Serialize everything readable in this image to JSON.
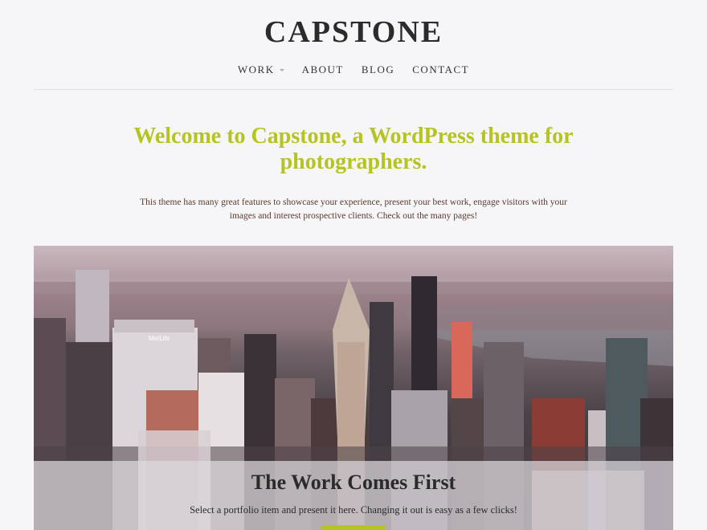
{
  "site": {
    "title": "CAPSTONE"
  },
  "nav": {
    "items": [
      {
        "label": "WORK",
        "has_dropdown": true
      },
      {
        "label": "ABOUT"
      },
      {
        "label": "BLOG"
      },
      {
        "label": "CONTACT"
      }
    ]
  },
  "main": {
    "headline": "Welcome to Capstone, a WordPress theme for photographers.",
    "intro": "This theme has many great features to showcase your experience, present your best work, engage visitors with your images and interest prospective clients. Check out the many pages!"
  },
  "hero": {
    "image": "new-york-city-skyline-aerial-photo",
    "caption_title": "The Work Comes First",
    "caption_text": "Select a portfolio item and present it here. Changing it out is easy as a few clicks!",
    "building_sign": "MetLife"
  },
  "colors": {
    "accent": "#b5c420",
    "background": "#f6f5f7",
    "text": "#2b2b2b",
    "intro_text": "#5b3b30"
  }
}
